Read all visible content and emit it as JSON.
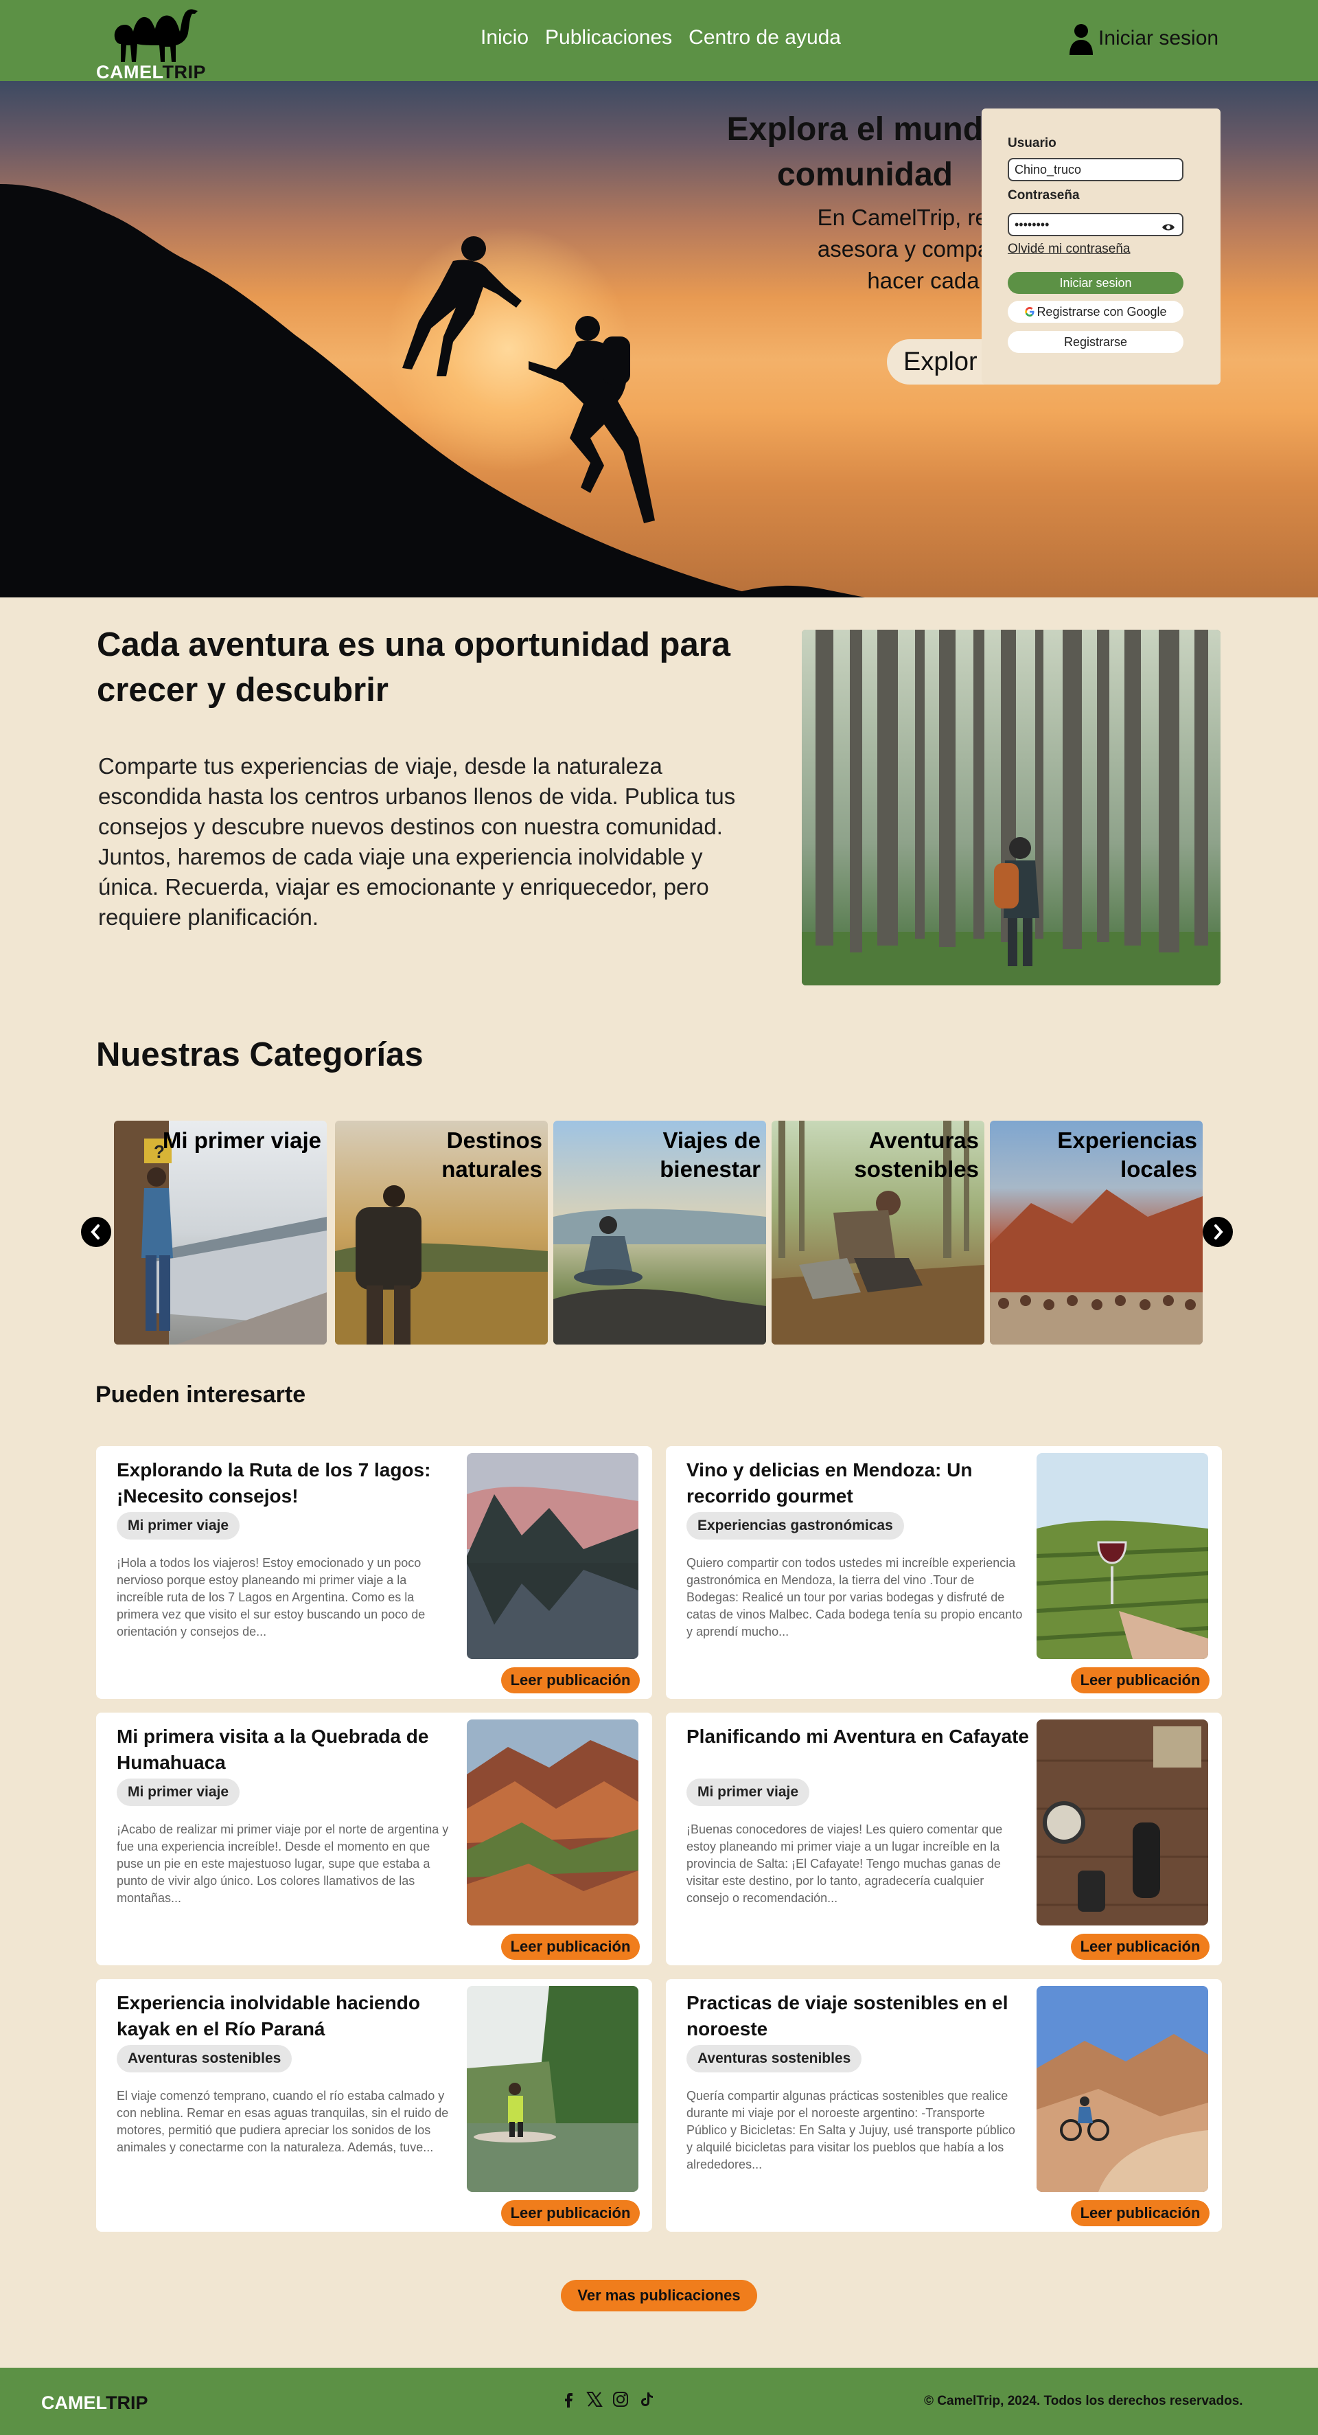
{
  "nav": {
    "logo_part1": "CAMEL",
    "logo_part2": "TRIP",
    "links": [
      "Inicio",
      "Publicaciones",
      "Centro de ayuda"
    ],
    "login": "Iniciar sesion"
  },
  "hero": {
    "title": "Explora el mundo comunidad",
    "description": "En CamelTrip, recibe asesora y comparte t hacer cada",
    "button": "Explor"
  },
  "login_panel": {
    "user_label": "Usuario",
    "user_value": "Chino_truco",
    "password_label": "Contraseña",
    "password_value": "••••••••",
    "forgot": "Olvidé mi contraseña",
    "login_button": "Iniciar sesion",
    "google_button": "Registrarse con Google",
    "register_button": "Registrarse"
  },
  "about": {
    "title": "Cada aventura es una oportunidad para crecer y descubrir",
    "text": "Comparte tus experiencias de viaje, desde la naturaleza escondida hasta los centros urbanos llenos de vida. Publica tus consejos y descubre nuevos destinos con nuestra comunidad. Juntos, haremos de cada viaje una experiencia inolvidable y única. Recuerda, viajar es emocionante y enriquecedor, pero requiere planificación."
  },
  "categories": {
    "title": "Nuestras Categorías",
    "items": [
      "Mi primer viaje",
      "Destinos naturales",
      "Viajes de bienestar",
      "Aventuras sostenibles",
      "Experiencias locales"
    ]
  },
  "posts": {
    "title": "Pueden interesarte",
    "read_label": "Leer publicación",
    "items": [
      {
        "title": "Explorando la Ruta de los 7 lagos: ¡Necesito consejos!",
        "tag": "Mi primer viaje",
        "body": "¡Hola a todos los viajeros! Estoy emocionado y un poco nervioso porque estoy planeando mi primer viaje a la increíble ruta de los 7 Lagos en Argentina. Como es la primera vez que visito el sur estoy buscando un poco de orientación y consejos de..."
      },
      {
        "title": "Vino y delicias en Mendoza: Un recorrido gourmet",
        "tag": "Experiencias gastronómicas",
        "body": "Quiero compartir con todos ustedes mi increíble experiencia gastronómica en Mendoza, la tierra del vino .Tour de Bodegas: Realicé un tour por varias bodegas y disfruté de catas de vinos Malbec. Cada bodega tenía su propio encanto y aprendí mucho..."
      },
      {
        "title": "Mi primera visita a la Quebrada de Humahuaca",
        "tag": "Mi primer viaje",
        "body": "¡Acabo de realizar mi primer viaje por el norte de argentina y fue una experiencia increíble!. Desde el momento en que puse un pie en este majestuoso lugar, supe que estaba a punto de vivir algo único. Los colores llamativos de las montañas..."
      },
      {
        "title": "Planificando mi Aventura en Cafayate",
        "tag": "Mi primer viaje",
        "body": "¡Buenas conocedores de viajes! Les quiero comentar que estoy planeando mi primer viaje a un lugar increíble en la provincia de Salta: ¡El Cafayate! Tengo muchas ganas de visitar este destino, por lo tanto, agradecería cualquier consejo o recomendación..."
      },
      {
        "title": "Experiencia inolvidable haciendo kayak en el Río Paraná",
        "tag": "Aventuras sostenibles",
        "body": "El viaje comenzó temprano, cuando el río estaba calmado y con neblina. Remar en esas aguas tranquilas, sin el ruido de motores, permitió que pudiera apreciar los sonidos de los animales y conectarme con la naturaleza. Además, tuve..."
      },
      {
        "title": "Practicas de viaje sostenibles en el noroeste",
        "tag": "Aventuras sostenibles",
        "body": "Quería compartir algunas prácticas sostenibles que realice durante mi viaje por el noroeste argentino: -Transporte Público y Bicicletas: En Salta y Jujuy, usé transporte público y alquilé bicicletas para visitar los pueblos que había a los alrededores..."
      }
    ],
    "more_button": "Ver mas publicaciones"
  },
  "footer": {
    "logo_part1": "CAMEL",
    "logo_part2": "TRIP",
    "copyright": "© CamelTrip, 2024. Todos los derechos reservados."
  },
  "colors": {
    "brand_green": "#5c9145",
    "accent_orange": "#f07d1c",
    "background": "#f1e6d2"
  }
}
